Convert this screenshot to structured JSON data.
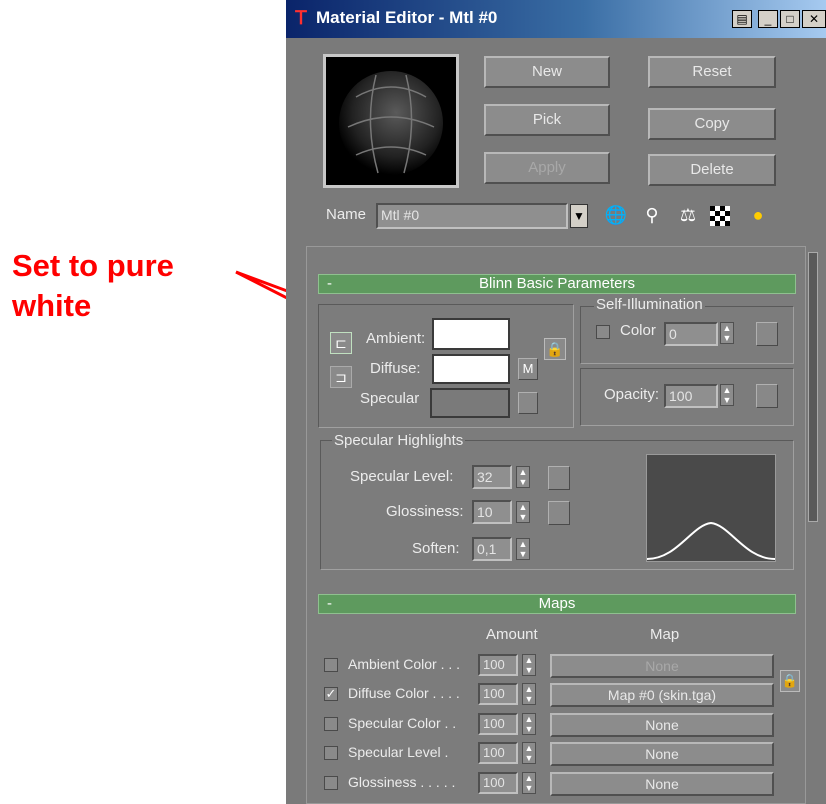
{
  "window": {
    "title": "Material Editor - Mtl #0",
    "icon": "3dsmax-logo-icon"
  },
  "annotation": {
    "line1": "Set to pure",
    "line2": "white",
    "color": "#ff0000"
  },
  "buttons": {
    "new": "New",
    "reset": "Reset",
    "pick": "Pick",
    "copy": "Copy",
    "apply": "Apply",
    "delete": "Delete"
  },
  "name_row": {
    "label": "Name",
    "value": "Mtl #0"
  },
  "blinn": {
    "header": "Blinn Basic Parameters",
    "ambient": "Ambient:",
    "diffuse": "Diffuse:",
    "specular": "Specular",
    "m_button": "M",
    "self_illum": {
      "title": "Self-Illumination",
      "color_label": "Color",
      "value": "0"
    },
    "opacity": {
      "label": "Opacity:",
      "value": "100"
    },
    "specular_highlights": {
      "title": "Specular Highlights",
      "level_label": "Specular Level:",
      "level_value": "32",
      "gloss_label": "Glossiness:",
      "gloss_value": "10",
      "soften_label": "Soften:",
      "soften_value": "0,1"
    }
  },
  "maps": {
    "header": "Maps",
    "amount_header": "Amount",
    "map_header": "Map",
    "rows": [
      {
        "label": "Ambient Color . . .",
        "checked": false,
        "amount": "100",
        "map": "None"
      },
      {
        "label": "Diffuse Color . . . .",
        "checked": true,
        "amount": "100",
        "map": "Map #0 (skin.tga)"
      },
      {
        "label": "Specular Color . .",
        "checked": false,
        "amount": "100",
        "map": "None"
      },
      {
        "label": "Specular Level .",
        "checked": false,
        "amount": "100",
        "map": "None"
      },
      {
        "label": "Glossiness . . . . .",
        "checked": false,
        "amount": "100",
        "map": "None"
      }
    ]
  },
  "colors": {
    "ambient": "#ffffff",
    "diffuse": "#ffffff",
    "specular": "#7a7a7a",
    "rollout_header": "#5e9a5e"
  }
}
